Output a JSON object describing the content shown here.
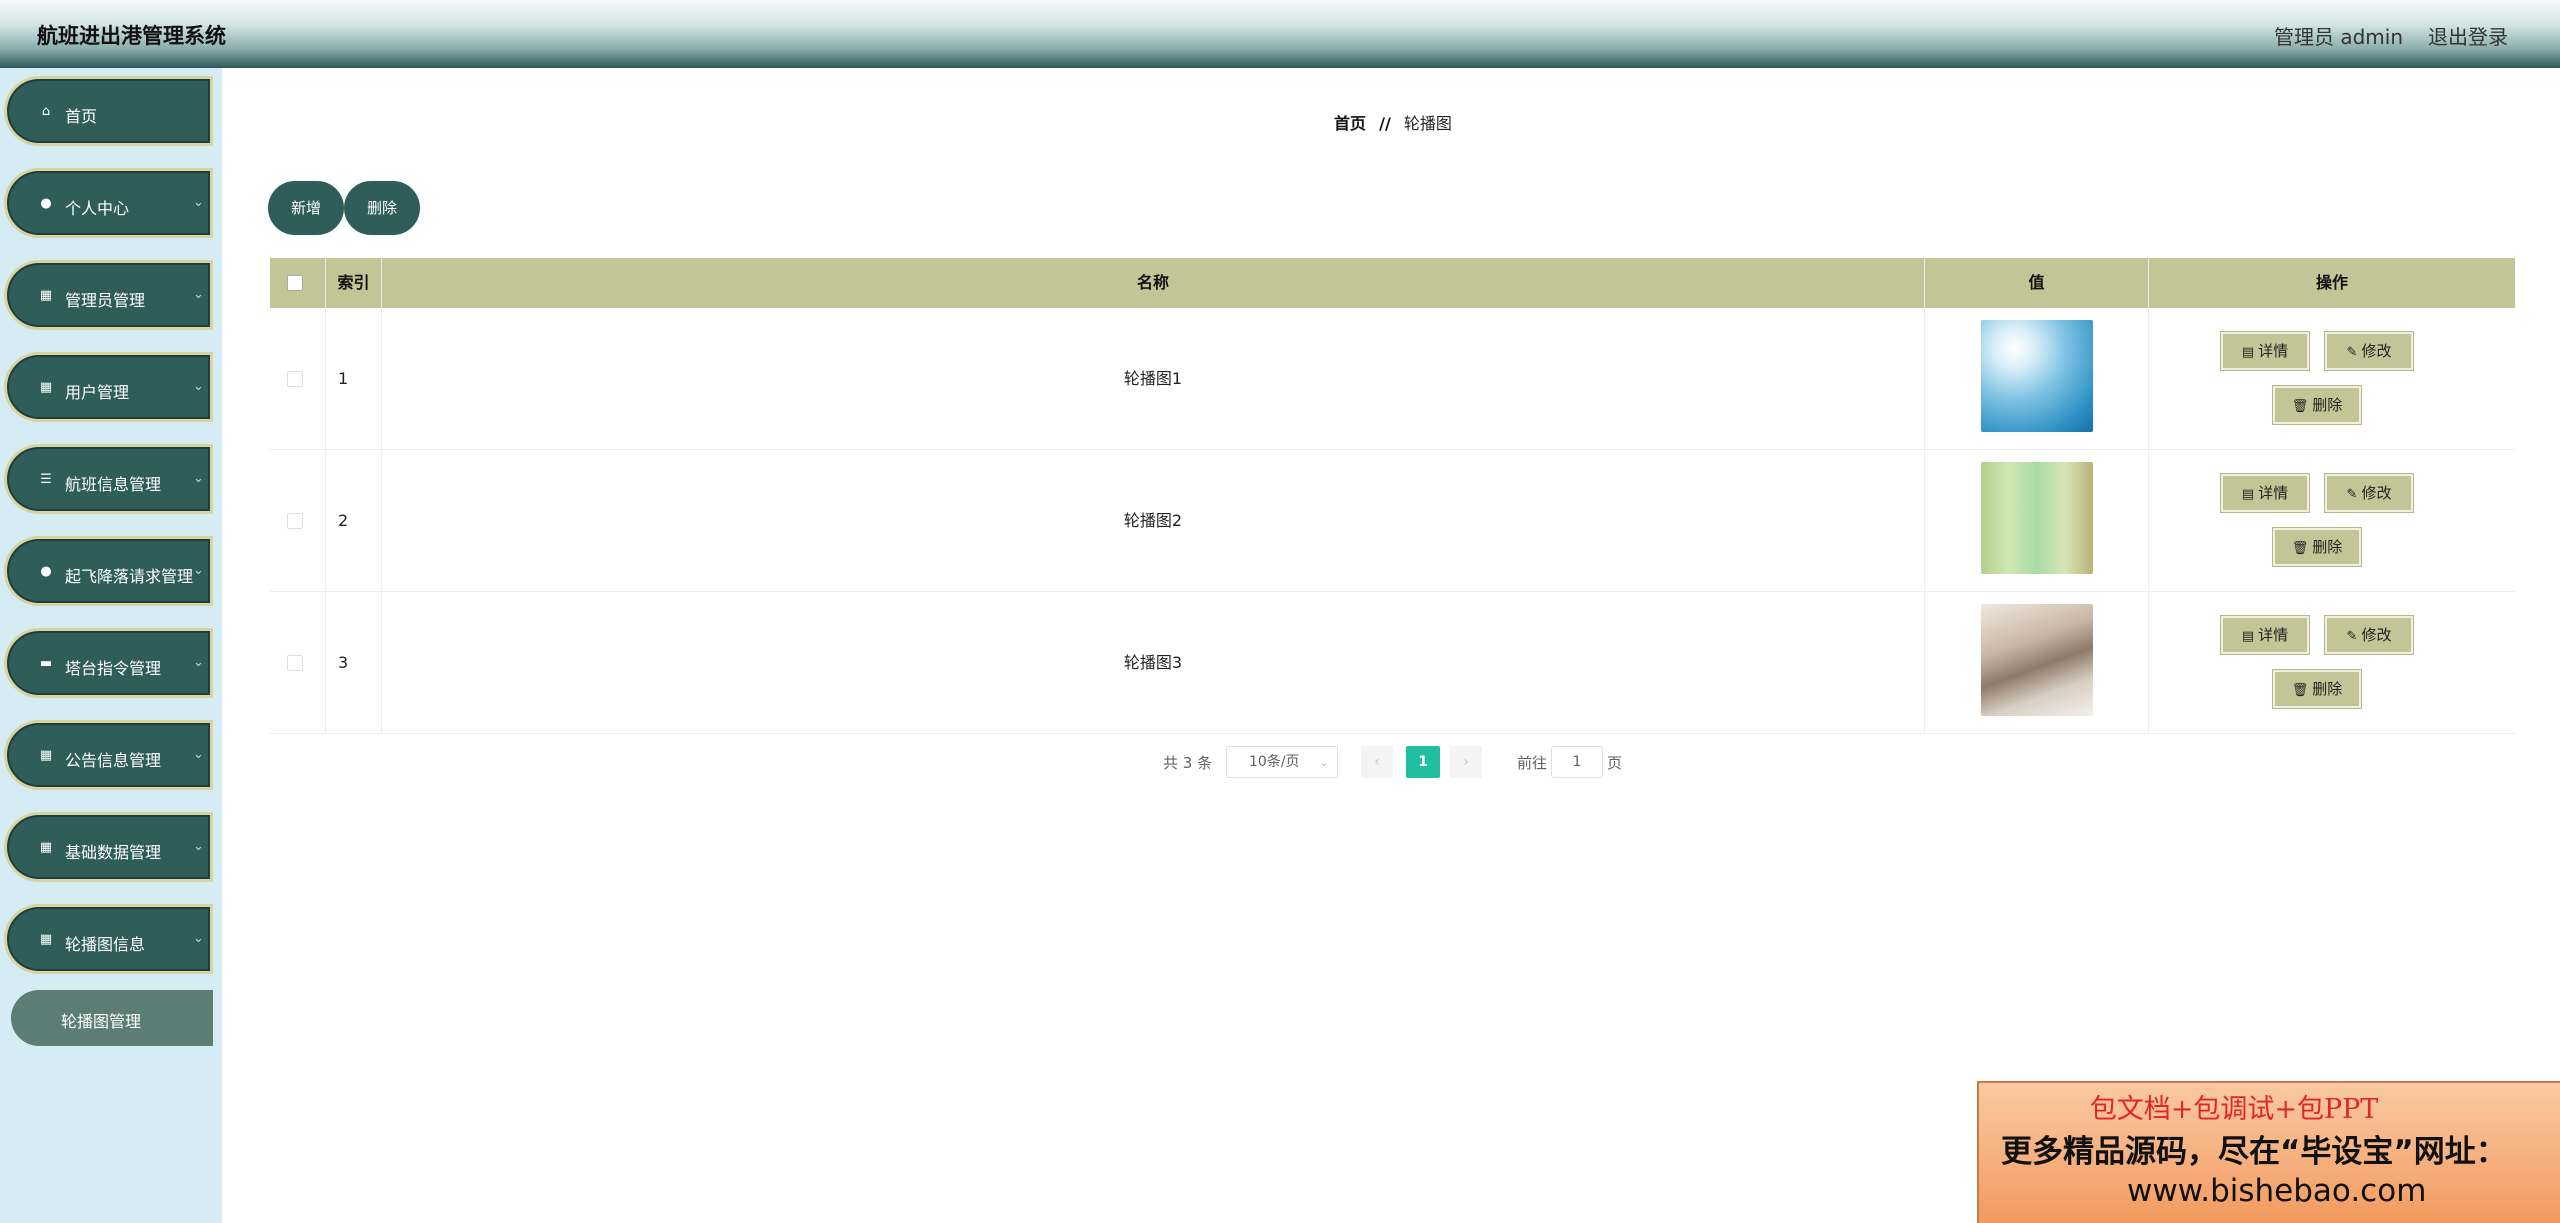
{
  "header": {
    "app_title": "航班进出港管理系统",
    "admin_label": "管理员 admin",
    "logout_label": "退出登录"
  },
  "sidebar": {
    "items": [
      {
        "label": "首页",
        "icon": "home-icon"
      },
      {
        "label": "个人中心",
        "icon": "user-icon"
      },
      {
        "label": "管理员管理",
        "icon": "grid-icon"
      },
      {
        "label": "用户管理",
        "icon": "grid-icon"
      },
      {
        "label": "航班信息管理",
        "icon": "list-icon"
      },
      {
        "label": "起飞降落请求管理",
        "icon": "location-pin-icon"
      },
      {
        "label": "塔台指令管理",
        "icon": "briefcase-icon"
      },
      {
        "label": "公告信息管理",
        "icon": "grid-icon"
      },
      {
        "label": "基础数据管理",
        "icon": "grid-icon"
      },
      {
        "label": "轮播图信息",
        "icon": "grid-icon"
      }
    ],
    "submenu_active": "轮播图管理"
  },
  "breadcrumb": {
    "home": "首页",
    "separator": "//",
    "current": "轮播图"
  },
  "toolbar": {
    "add_label": "新增",
    "delete_label": "删除"
  },
  "table": {
    "headers": [
      "索引",
      "名称",
      "值",
      "操作"
    ],
    "rows": [
      {
        "index": "1",
        "name": "轮播图1",
        "image": "sky-clouds-thumbnail"
      },
      {
        "index": "2",
        "name": "轮播图2",
        "image": "green-blur-thumbnail"
      },
      {
        "index": "3",
        "name": "轮播图3",
        "image": "street-scene-thumbnail"
      }
    ],
    "actions": {
      "detail_label": "详情",
      "edit_label": "修改",
      "delete_label": "删除"
    }
  },
  "pagination": {
    "total_label": "共 3 条",
    "page_size_label": "10条/页",
    "current_page": "1",
    "goto_label": "前往",
    "goto_value": "1",
    "page_unit": "页"
  },
  "ad_banner": {
    "line1": "包文档+包调试+包PPT",
    "line2": "更多精品源码，尽在“毕设宝”网址：",
    "line3": "www.bishebao.com"
  },
  "colors": {
    "header_dark": "#2f5a5a",
    "menu_bg": "#2f5d5a",
    "menu_border": "#d9d3a2",
    "sidebar_bg": "#d6ecf4",
    "table_header_bg": "#c3c596",
    "pagination_active": "#1fbf9f"
  }
}
